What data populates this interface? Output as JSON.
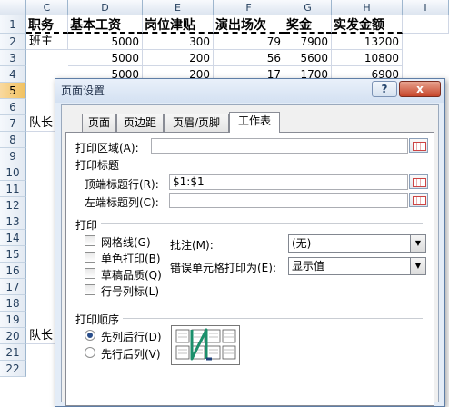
{
  "sheet": {
    "columns": [
      "C",
      "D",
      "E",
      "F",
      "G",
      "H",
      "I"
    ],
    "rows": [
      "1",
      "2",
      "3",
      "4",
      "5",
      "6",
      "7",
      "8",
      "9",
      "10",
      "11",
      "12",
      "13",
      "14",
      "15",
      "16",
      "17",
      "18",
      "19",
      "20",
      "21",
      "22"
    ],
    "selected_row": "5",
    "header": [
      "职务",
      "基本工资",
      "岗位津贴",
      "演出场次",
      "奖金",
      "实发金额"
    ],
    "r2": [
      "班主",
      "5000",
      "300",
      "79",
      "7900",
      "13200"
    ],
    "r3": [
      "5000",
      "200",
      "56",
      "5600",
      "10800"
    ],
    "r4": [
      "5000",
      "200",
      "17",
      "1700",
      "6900"
    ],
    "r7": "队长",
    "r20": "队长"
  },
  "dialog": {
    "title": "页面设置",
    "help": "?",
    "close": "x",
    "tabs": [
      "页面",
      "页边距",
      "页眉/页脚",
      "工作表"
    ],
    "print_area_label": "打印区域(A):",
    "print_titles_label": "打印标题",
    "top_rows_label": "顶端标题行(R):",
    "top_rows_value": "$1:$1",
    "left_cols_label": "左端标题列(C):",
    "print_label": "打印",
    "gridlines": "网格线(G)",
    "monochrome": "单色打印(B)",
    "draft": "草稿品质(Q)",
    "row_col_headers": "行号列标(L)",
    "comments_label": "批注(M):",
    "comments_value": "(无)",
    "errors_label": "错误单元格打印为(E):",
    "errors_value": "显示值",
    "order_label": "打印顺序",
    "down_then_over": "先列后行(D)",
    "over_then_down": "先行后列(V)",
    "down_then_over_selected": true
  }
}
